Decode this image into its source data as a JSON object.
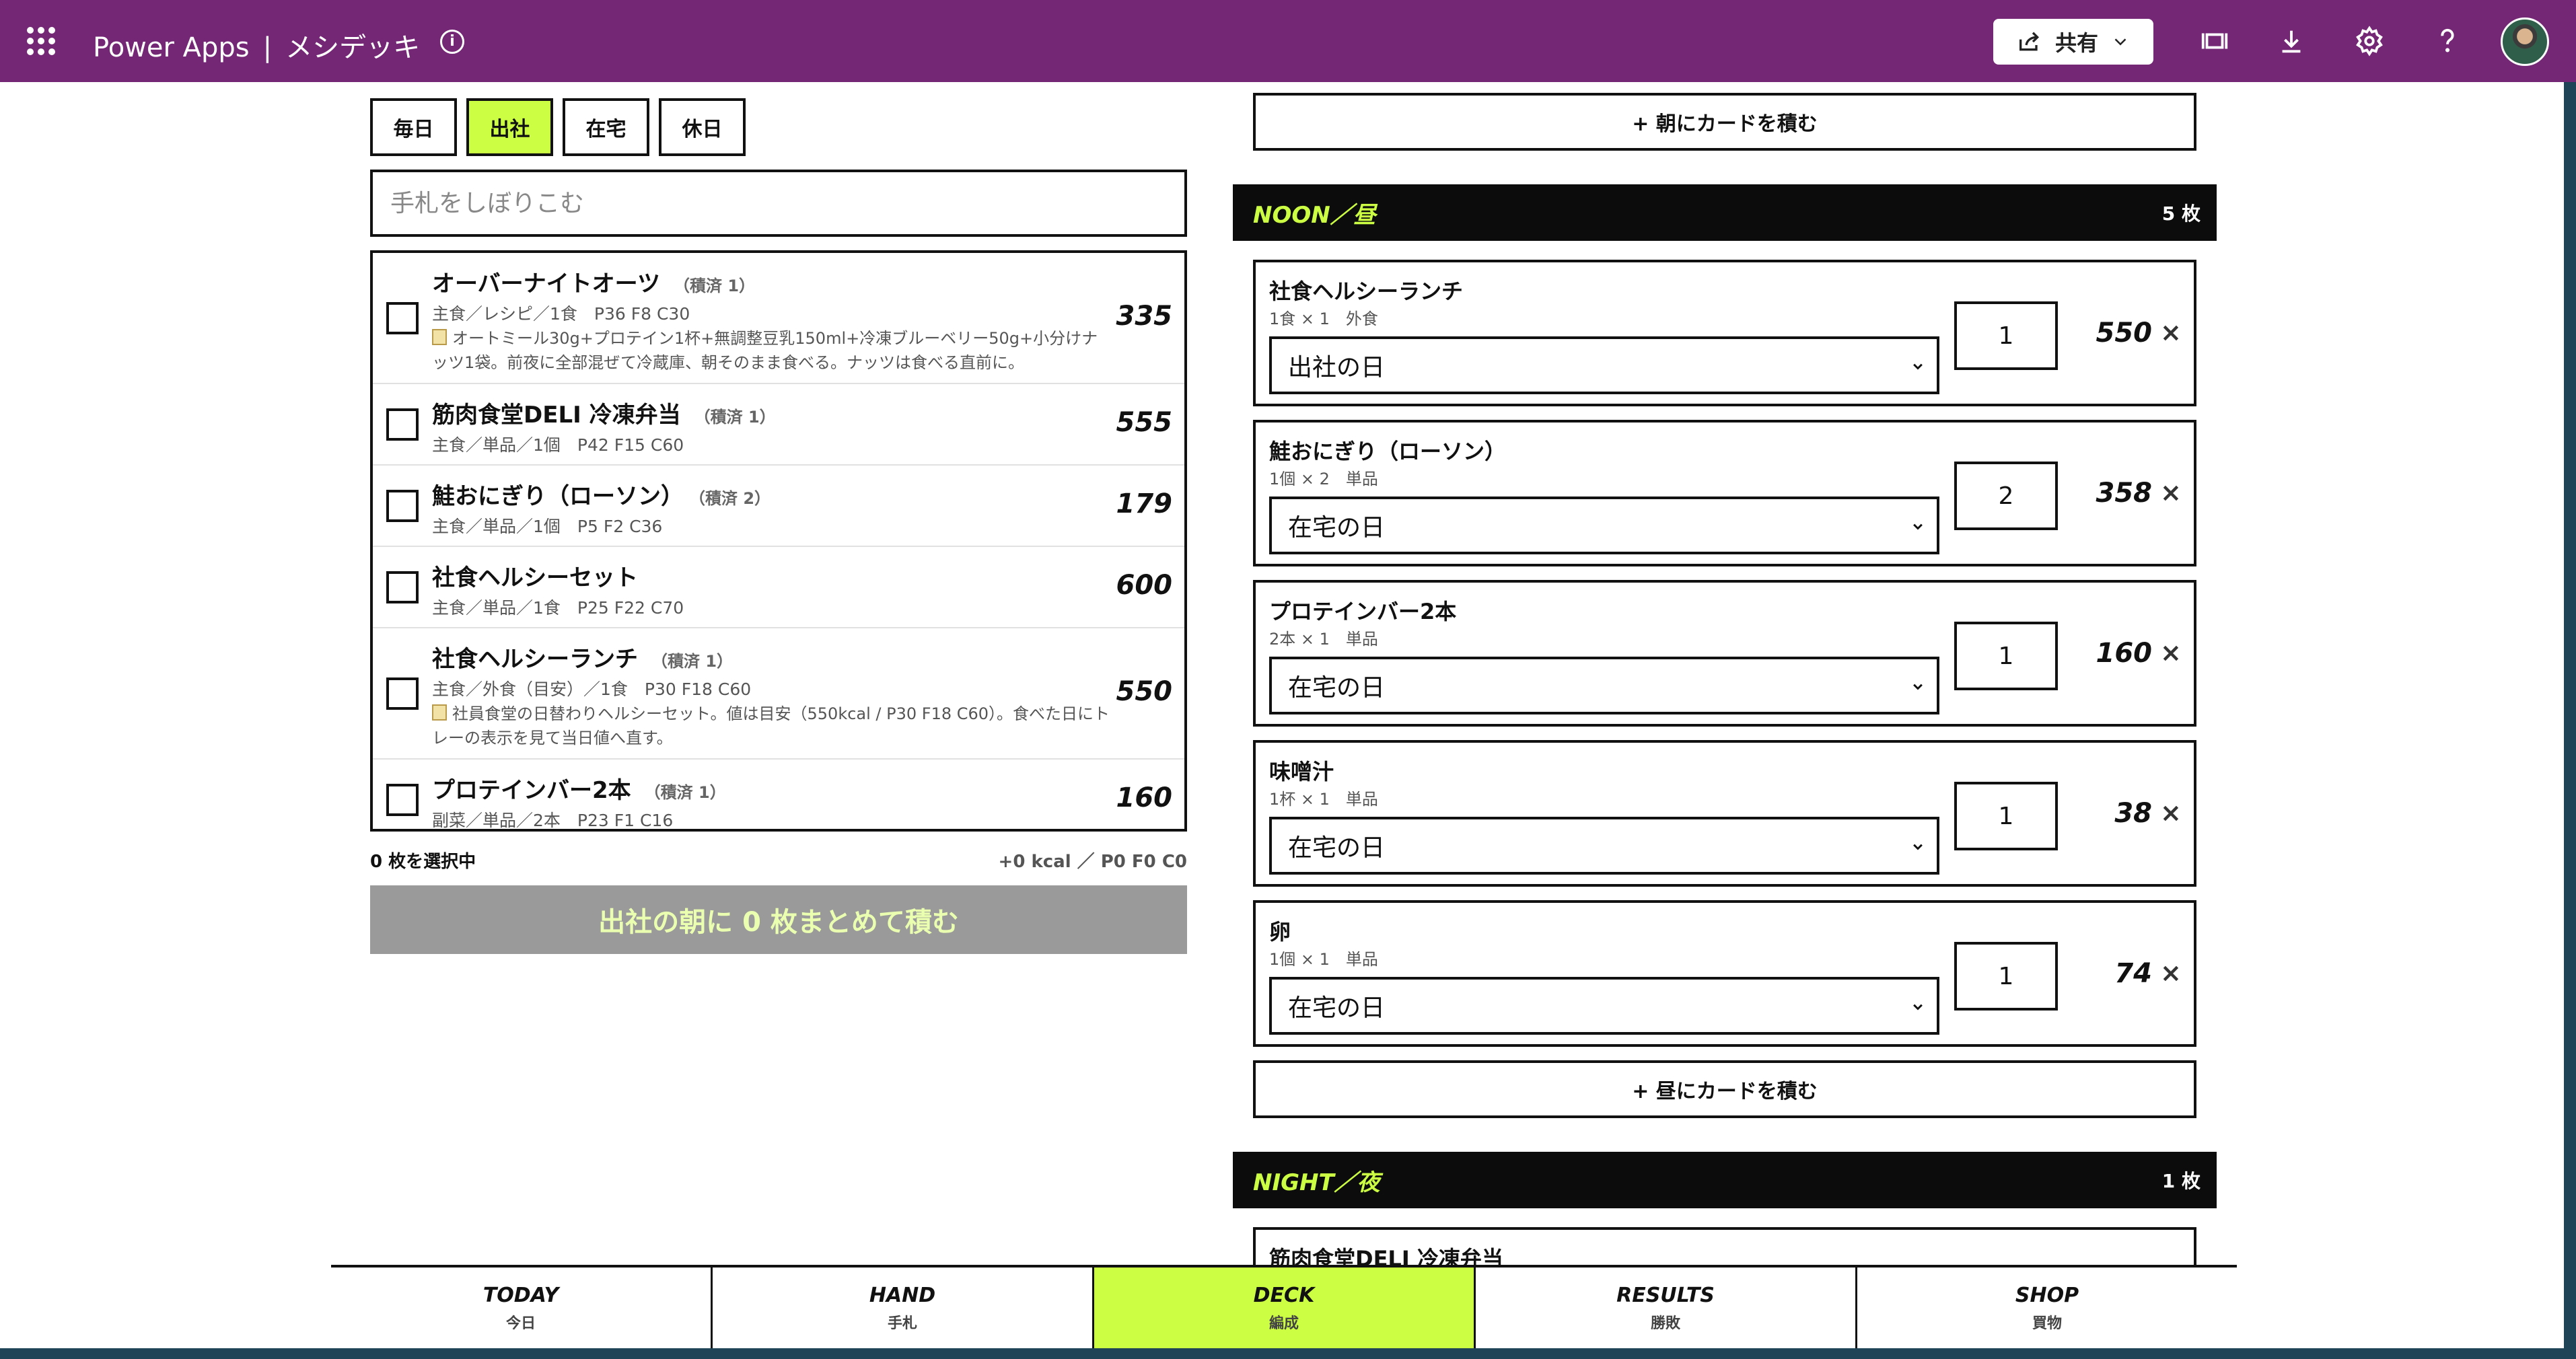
{
  "topbar": {
    "product": "Power Apps",
    "separator": "|",
    "app_name": "メシデッキ",
    "info_icon": "info-icon",
    "share_label": "共有",
    "icons": [
      "share-icon",
      "fit-screen-icon",
      "download-icon",
      "gear-icon",
      "help-icon"
    ],
    "bg_color": "#742774"
  },
  "day_tabs": {
    "items": [
      {
        "label": "毎日",
        "active": false
      },
      {
        "label": "出社",
        "active": true
      },
      {
        "label": "在宅",
        "active": false
      },
      {
        "label": "休日",
        "active": false
      }
    ],
    "active_color": "#ccff44"
  },
  "hand": {
    "filter_placeholder": "手札をしぼりこむ",
    "items": [
      {
        "name": "オーバーナイトオーツ",
        "badge": "（積済 1）",
        "meta": "主食／レシピ／1食　P36 F8 C30",
        "note": "オートミール30g+プロテイン1杯+無調整豆乳150ml+冷凍ブルーベリー50g+小分けナッツ1袋。前夜に全部混ぜて冷蔵庫、朝そのまま食べる。ナッツは食べる直前に。",
        "kcal": "335"
      },
      {
        "name": "筋肉食堂DELI 冷凍弁当",
        "badge": "（積済 1）",
        "meta": "主食／単品／1個　P42 F15 C60",
        "note": "",
        "kcal": "555"
      },
      {
        "name": "鮭おにぎり（ローソン）",
        "badge": "（積済 2）",
        "meta": "主食／単品／1個　P5 F2 C36",
        "note": "",
        "kcal": "179"
      },
      {
        "name": "社食ヘルシーセット",
        "badge": "",
        "meta": "主食／単品／1食　P25 F22 C70",
        "note": "",
        "kcal": "600"
      },
      {
        "name": "社食ヘルシーランチ",
        "badge": "（積済 1）",
        "meta": "主食／外食（目安）／1食　P30 F18 C60",
        "note": "社員食堂の日替わりヘルシーセット。値は目安（550kcal / P30 F18 C60）。食べた日にトレーの表示を見て当日値へ直す。",
        "kcal": "550"
      },
      {
        "name": "プロテインバー2本",
        "badge": "（積済 1）",
        "meta": "副菜／単品／2本　P23 F1 C16",
        "note": "",
        "kcal": "160"
      }
    ],
    "selected_count": "0 枚を選択中",
    "selected_total": "+0 kcal ／ P0 F0 C0",
    "stack_button": "出社の朝に 0 枚まとめて積む"
  },
  "deck": {
    "add_morning": "+ 朝にカードを積む",
    "noon": {
      "title": "NOON／昼",
      "count": "5 枚",
      "cards": [
        {
          "name": "社食ヘルシーランチ",
          "meta": "1食 × 1　外食",
          "day": "出社の日",
          "qty": "1",
          "kcal": "550"
        },
        {
          "name": "鮭おにぎり（ローソン）",
          "meta": "1個 × 2　単品",
          "day": "在宅の日",
          "qty": "2",
          "kcal": "358"
        },
        {
          "name": "プロテインバー2本",
          "meta": "2本 × 1　単品",
          "day": "在宅の日",
          "qty": "1",
          "kcal": "160"
        },
        {
          "name": "味噌汁",
          "meta": "1杯 × 1　単品",
          "day": "在宅の日",
          "qty": "1",
          "kcal": "38"
        },
        {
          "name": "卵",
          "meta": "1個 × 1　単品",
          "day": "在宅の日",
          "qty": "1",
          "kcal": "74"
        }
      ],
      "add_label": "+ 昼にカードを積む"
    },
    "night": {
      "title": "NIGHT／夜",
      "count": "1 枚",
      "first_card_name": "筋肉食堂DELI 冷凍弁当"
    },
    "delete_glyph": "×"
  },
  "bottom_nav": {
    "items": [
      {
        "en": "TODAY",
        "jp": "今日",
        "active": false
      },
      {
        "en": "HAND",
        "jp": "手札",
        "active": false
      },
      {
        "en": "DECK",
        "jp": "編成",
        "active": true
      },
      {
        "en": "RESULTS",
        "jp": "勝敗",
        "active": false
      },
      {
        "en": "SHOP",
        "jp": "買物",
        "active": false
      }
    ]
  }
}
